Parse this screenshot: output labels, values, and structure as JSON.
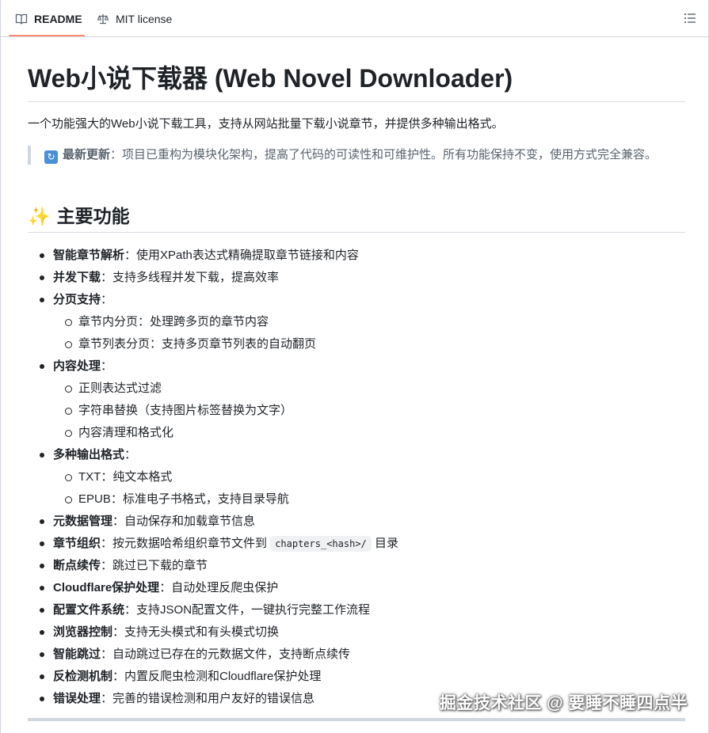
{
  "tabs": [
    {
      "label": "README",
      "icon": "book-icon",
      "active": true
    },
    {
      "label": "MIT license",
      "icon": "law-scale-icon",
      "active": false
    }
  ],
  "toc_icon": "list-unordered-icon",
  "readme": {
    "title": "Web小说下载器 (Web Novel Downloader)",
    "intro": "一个功能强大的Web小说下载工具，支持从网站批量下载小说章节，并提供多种输出格式。",
    "update": {
      "icon": "arrows-cycle-icon",
      "label": "最新更新",
      "text": "：项目已重构为模块化架构，提高了代码的可读性和可维护性。所有功能保持不变，使用方式完全兼容。"
    },
    "features_heading": {
      "emoji": "sparkles-icon",
      "text": "主要功能"
    },
    "features": [
      {
        "name": "智能章节解析",
        "desc": "：使用XPath表达式精确提取章节链接和内容"
      },
      {
        "name": "并发下载",
        "desc": "：支持多线程并发下载，提高效率"
      },
      {
        "name": "分页支持",
        "desc": "：",
        "sub": [
          "章节内分页：处理跨多页的章节内容",
          "章节列表分页：支持多页章节列表的自动翻页"
        ]
      },
      {
        "name": "内容处理",
        "desc": "：",
        "sub": [
          "正则表达式过滤",
          "字符串替换（支持图片标签替换为文字）",
          "内容清理和格式化"
        ]
      },
      {
        "name": "多种输出格式",
        "desc": "：",
        "sub": [
          "TXT：纯文本格式",
          "EPUB：标准电子书格式，支持目录导航"
        ]
      },
      {
        "name": "元数据管理",
        "desc": "：自动保存和加载章节信息"
      },
      {
        "name": "章节组织",
        "desc": "：按元数据哈希组织章节文件到 ",
        "code": "chapters_<hash>/",
        "after": " 目录"
      },
      {
        "name": "断点续传",
        "desc": "：跳过已下载的章节"
      },
      {
        "name": "Cloudflare保护处理",
        "desc": "：自动处理反爬虫保护"
      },
      {
        "name": "配置文件系统",
        "desc": "：支持JSON配置文件，一键执行完整工作流程"
      },
      {
        "name": "浏览器控制",
        "desc": "：支持无头模式和有头模式切换"
      },
      {
        "name": "智能跳过",
        "desc": "：自动跳过已存在的元数据文件，支持断点续传"
      },
      {
        "name": "反检测机制",
        "desc": "：内置反爬虫检测和Cloudflare保护处理"
      },
      {
        "name": "错误处理",
        "desc": "：完善的错误检测和用户友好的错误信息"
      }
    ]
  },
  "watermark": "掘金技术社区 @ 要睡不睡四点半",
  "colors": {
    "accent": "#fd8c73",
    "text": "#1f2328",
    "muted": "#59636e",
    "border": "#d0d7de"
  }
}
